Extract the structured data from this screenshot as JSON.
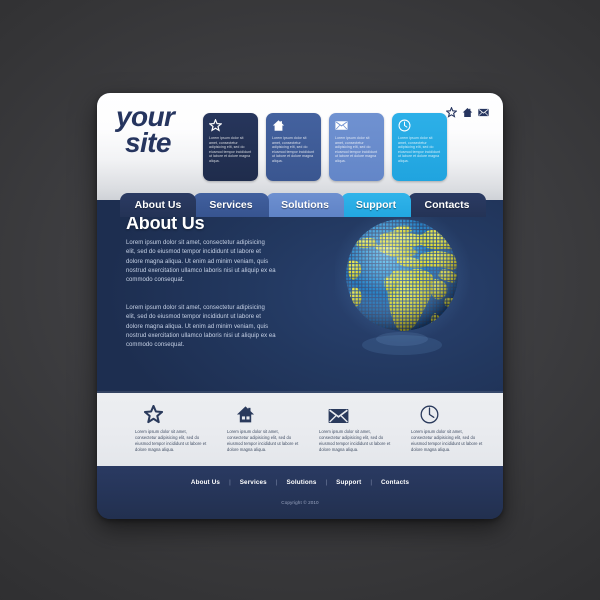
{
  "site": {
    "logo_line1": "your",
    "logo_line2": "site"
  },
  "colors": {
    "page_background": "#3a3a3c",
    "navy_dark": "#26355f",
    "blue_medium": "#3f5d9a",
    "blue_light": "#6a8ccb",
    "cyan_bright": "#22a7e1",
    "panel_dark": "#233961",
    "features_bg": "#e9ebef",
    "globe_land": "#e8e330",
    "globe_ocean": "#1f7fc4"
  },
  "header": {
    "social_icons": [
      {
        "name": "star-icon",
        "glyph": "star"
      },
      {
        "name": "home-icon",
        "glyph": "home"
      },
      {
        "name": "mail-icon",
        "glyph": "mail"
      }
    ],
    "feature_boxes": [
      {
        "icon": "star-icon",
        "text": "Lorem ipsum dolor sit amet, consectetur adipisicing elit, sed do eiusmod tempor incididunt ut labore et dolore magna aliqua.",
        "color": "#27365c"
      },
      {
        "icon": "home-icon",
        "text": "Lorem ipsum dolor sit amet, consectetur adipisicing elit, sed do eiusmod tempor incididunt ut labore et dolore magna aliqua.",
        "color": "#44629f"
      },
      {
        "icon": "mail-icon",
        "text": "Lorem ipsum dolor sit amet, consectetur adipisicing elit, sed do eiusmod tempor incididunt ut labore et dolore magna aliqua.",
        "color": "#7092d1"
      },
      {
        "icon": "clock-icon",
        "text": "Lorem ipsum dolor sit amet, consectetur adipisicing elit, sed do eiusmod tempor incididunt ut labore et dolore magna aliqua.",
        "color": "#2db0e8"
      }
    ]
  },
  "nav": {
    "tabs": [
      {
        "label": "About Us",
        "active": true,
        "color": "#2b3b63"
      },
      {
        "label": "Services",
        "active": false,
        "color": "#41609e"
      },
      {
        "label": "Solutions",
        "active": false,
        "color": "#6e90d0"
      },
      {
        "label": "Support",
        "active": false,
        "color": "#31b4ea"
      },
      {
        "label": "Contacts",
        "active": false,
        "color": "#2b3b63"
      }
    ]
  },
  "main": {
    "title": "About Us",
    "paragraphs": [
      "Lorem ipsum dolor sit amet, consectetur adipisicing elit, sed do eiusmod tempor incididunt ut labore et dolore magna aliqua. Ut enim ad minim veniam, quis nostrud exercitation ullamco laboris nisi ut aliquip ex ea commodo consequat.",
      "Lorem ipsum dolor sit amet, consectetur adipisicing elit, sed do eiusmod tempor incididunt ut labore et dolore magna aliqua. Ut enim ad minim veniam, quis nostrud exercitation ullamco laboris nisi ut aliquip ex ea commodo consequat."
    ],
    "illustration": "dotted-globe"
  },
  "features": [
    {
      "icon": "star-icon",
      "text": "Lorem ipsum dolor sit amet, consectetur adipisicing elit, sed do eiusmod tempor incididunt ut labore et dolore magna aliqua."
    },
    {
      "icon": "home-icon",
      "text": "Lorem ipsum dolor sit amet, consectetur adipisicing elit, sed do eiusmod tempor incididunt ut labore et dolore magna aliqua."
    },
    {
      "icon": "mail-icon",
      "text": "Lorem ipsum dolor sit amet, consectetur adipisicing elit, sed do eiusmod tempor incididunt ut labore et dolore magna aliqua."
    },
    {
      "icon": "clock-icon",
      "text": "Lorem ipsum dolor sit amet, consectetur adipisicing elit, sed do eiusmod tempor incididunt ut labore et dolore magna aliqua."
    }
  ],
  "footer": {
    "links": [
      "About Us",
      "Services",
      "Solutions",
      "Support",
      "Contacts"
    ],
    "separator": "|",
    "copyright": "Copyright © 2010"
  }
}
